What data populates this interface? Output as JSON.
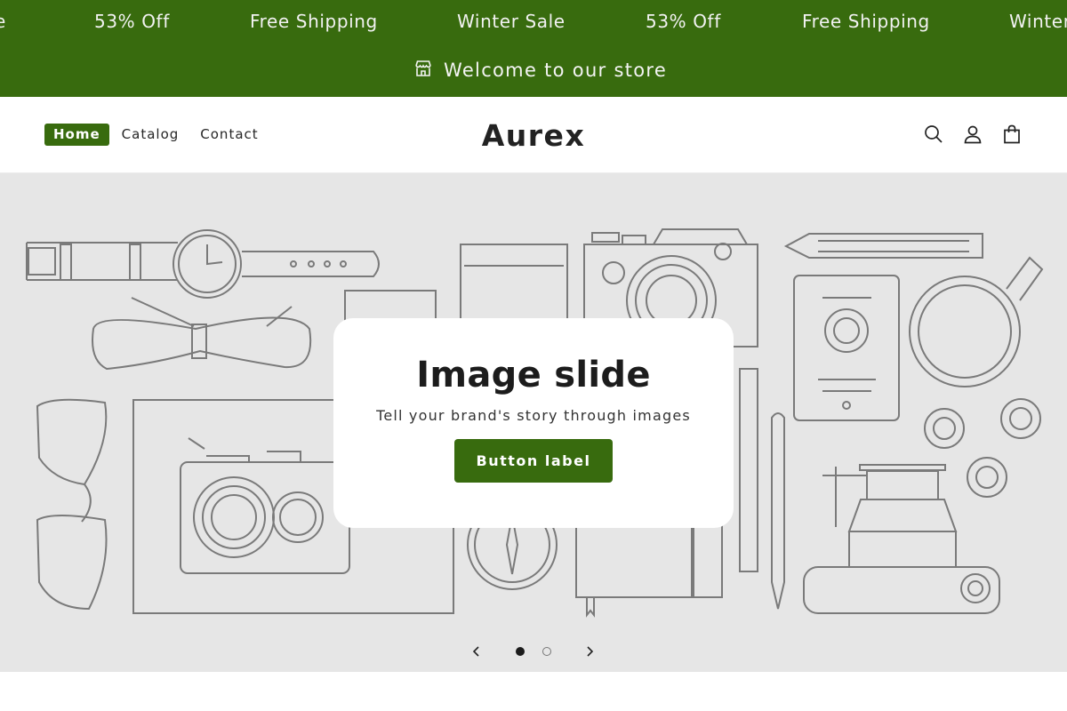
{
  "ticker": {
    "items": [
      "e",
      "53% Off",
      "Free Shipping",
      "Winter Sale",
      "53% Off",
      "Free Shipping",
      "Winter"
    ]
  },
  "announcement": {
    "icon": "store-icon",
    "text": "Welcome to our store"
  },
  "header": {
    "nav": [
      "Home",
      "Catalog",
      "Contact"
    ],
    "active_nav": "Home",
    "logo": "Aurex",
    "icons": [
      "search-icon",
      "account-icon",
      "cart-icon"
    ]
  },
  "hero": {
    "title": "Image slide",
    "subtitle": "Tell your brand's story through images",
    "button_label": "Button label",
    "slides_total": 2,
    "current_slide": 1
  },
  "colors": {
    "brand": "#386b0e",
    "hero_bg": "#e6e6e6"
  }
}
